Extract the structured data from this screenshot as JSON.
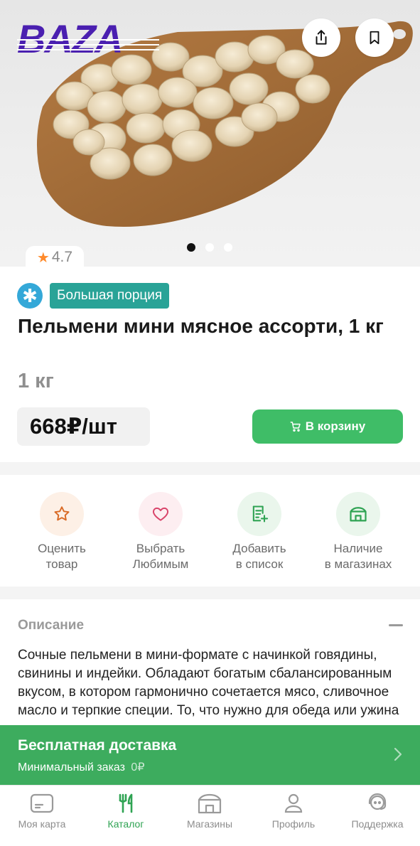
{
  "header": {
    "logo_text": "BAZA",
    "share_icon": "share-icon",
    "bookmark_icon": "bookmark-icon",
    "carousel": {
      "total": 3,
      "active_index": 1
    }
  },
  "product": {
    "rating": "4.7",
    "badge_label": "Большая порция",
    "title": "Пельмени мини мясное ассорти, 1 кг",
    "weight": "1 кг",
    "price": "668₽/шт",
    "cart_label": "В корзину"
  },
  "actions": [
    {
      "id": "rate",
      "icon": "star-icon",
      "label_line1": "Оценить",
      "label_line2": "товар",
      "bg": "#fdf0e6",
      "color": "#d96a25"
    },
    {
      "id": "favorite",
      "icon": "heart-icon",
      "label_line1": "Выбрать",
      "label_line2": "Любимым",
      "bg": "#fdeef1",
      "color": "#d9446a"
    },
    {
      "id": "add-list",
      "icon": "list-add-icon",
      "label_line1": "Добавить",
      "label_line2": "в список",
      "bg": "#eaf6ec",
      "color": "#2fa353"
    },
    {
      "id": "stores",
      "icon": "store-icon",
      "label_line1": "Наличие",
      "label_line2": "в магазинах",
      "bg": "#eaf6ec",
      "color": "#2fa353"
    }
  ],
  "description": {
    "heading": "Описание",
    "text": "Сочные пельмени в мини-формате с начинкой говядины, свинины и индейки. Обладают богатым сбалансированным вкусом, в котором гармонично сочетается мясо, сливочное масло и терпкие специи. То, что нужно для обеда или ужина на"
  },
  "delivery": {
    "title": "Бесплатная доставка",
    "min_order_label": "Минимальный заказ",
    "min_order_value": "0₽"
  },
  "nav": [
    {
      "label": "Моя карта",
      "icon": "card-icon",
      "active": false
    },
    {
      "label": "Каталог",
      "icon": "fork-knife-icon",
      "active": true
    },
    {
      "label": "Магазины",
      "icon": "store-icon",
      "active": false
    },
    {
      "label": "Профиль",
      "icon": "profile-icon",
      "active": false
    },
    {
      "label": "Поддержка",
      "icon": "support-icon",
      "active": false
    }
  ],
  "colors": {
    "accent_green": "#3fbd67",
    "banner_green": "#3dac5e",
    "badge_teal": "#29a397",
    "snow_blue": "#34a8d8",
    "star_orange": "#ff8a2b"
  }
}
